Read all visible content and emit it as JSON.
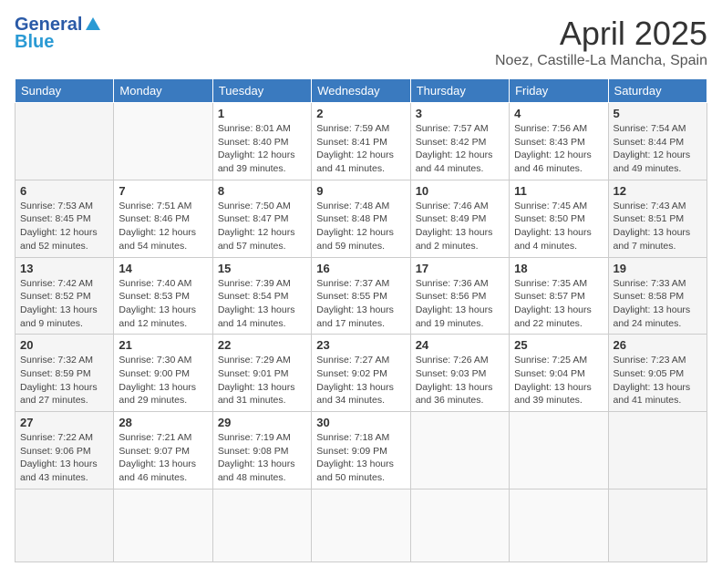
{
  "header": {
    "logo_general": "General",
    "logo_blue": "Blue",
    "title": "April 2025",
    "subtitle": "Noez, Castille-La Mancha, Spain"
  },
  "weekdays": [
    "Sunday",
    "Monday",
    "Tuesday",
    "Wednesday",
    "Thursday",
    "Friday",
    "Saturday"
  ],
  "days": [
    {
      "num": "",
      "sunrise": "",
      "sunset": "",
      "daylight": "",
      "empty": true
    },
    {
      "num": "",
      "sunrise": "",
      "sunset": "",
      "daylight": "",
      "empty": true
    },
    {
      "num": "1",
      "sunrise": "Sunrise: 8:01 AM",
      "sunset": "Sunset: 8:40 PM",
      "daylight": "Daylight: 12 hours and 39 minutes."
    },
    {
      "num": "2",
      "sunrise": "Sunrise: 7:59 AM",
      "sunset": "Sunset: 8:41 PM",
      "daylight": "Daylight: 12 hours and 41 minutes."
    },
    {
      "num": "3",
      "sunrise": "Sunrise: 7:57 AM",
      "sunset": "Sunset: 8:42 PM",
      "daylight": "Daylight: 12 hours and 44 minutes."
    },
    {
      "num": "4",
      "sunrise": "Sunrise: 7:56 AM",
      "sunset": "Sunset: 8:43 PM",
      "daylight": "Daylight: 12 hours and 46 minutes."
    },
    {
      "num": "5",
      "sunrise": "Sunrise: 7:54 AM",
      "sunset": "Sunset: 8:44 PM",
      "daylight": "Daylight: 12 hours and 49 minutes."
    },
    {
      "num": "6",
      "sunrise": "Sunrise: 7:53 AM",
      "sunset": "Sunset: 8:45 PM",
      "daylight": "Daylight: 12 hours and 52 minutes."
    },
    {
      "num": "7",
      "sunrise": "Sunrise: 7:51 AM",
      "sunset": "Sunset: 8:46 PM",
      "daylight": "Daylight: 12 hours and 54 minutes."
    },
    {
      "num": "8",
      "sunrise": "Sunrise: 7:50 AM",
      "sunset": "Sunset: 8:47 PM",
      "daylight": "Daylight: 12 hours and 57 minutes."
    },
    {
      "num": "9",
      "sunrise": "Sunrise: 7:48 AM",
      "sunset": "Sunset: 8:48 PM",
      "daylight": "Daylight: 12 hours and 59 minutes."
    },
    {
      "num": "10",
      "sunrise": "Sunrise: 7:46 AM",
      "sunset": "Sunset: 8:49 PM",
      "daylight": "Daylight: 13 hours and 2 minutes."
    },
    {
      "num": "11",
      "sunrise": "Sunrise: 7:45 AM",
      "sunset": "Sunset: 8:50 PM",
      "daylight": "Daylight: 13 hours and 4 minutes."
    },
    {
      "num": "12",
      "sunrise": "Sunrise: 7:43 AM",
      "sunset": "Sunset: 8:51 PM",
      "daylight": "Daylight: 13 hours and 7 minutes."
    },
    {
      "num": "13",
      "sunrise": "Sunrise: 7:42 AM",
      "sunset": "Sunset: 8:52 PM",
      "daylight": "Daylight: 13 hours and 9 minutes."
    },
    {
      "num": "14",
      "sunrise": "Sunrise: 7:40 AM",
      "sunset": "Sunset: 8:53 PM",
      "daylight": "Daylight: 13 hours and 12 minutes."
    },
    {
      "num": "15",
      "sunrise": "Sunrise: 7:39 AM",
      "sunset": "Sunset: 8:54 PM",
      "daylight": "Daylight: 13 hours and 14 minutes."
    },
    {
      "num": "16",
      "sunrise": "Sunrise: 7:37 AM",
      "sunset": "Sunset: 8:55 PM",
      "daylight": "Daylight: 13 hours and 17 minutes."
    },
    {
      "num": "17",
      "sunrise": "Sunrise: 7:36 AM",
      "sunset": "Sunset: 8:56 PM",
      "daylight": "Daylight: 13 hours and 19 minutes."
    },
    {
      "num": "18",
      "sunrise": "Sunrise: 7:35 AM",
      "sunset": "Sunset: 8:57 PM",
      "daylight": "Daylight: 13 hours and 22 minutes."
    },
    {
      "num": "19",
      "sunrise": "Sunrise: 7:33 AM",
      "sunset": "Sunset: 8:58 PM",
      "daylight": "Daylight: 13 hours and 24 minutes."
    },
    {
      "num": "20",
      "sunrise": "Sunrise: 7:32 AM",
      "sunset": "Sunset: 8:59 PM",
      "daylight": "Daylight: 13 hours and 27 minutes."
    },
    {
      "num": "21",
      "sunrise": "Sunrise: 7:30 AM",
      "sunset": "Sunset: 9:00 PM",
      "daylight": "Daylight: 13 hours and 29 minutes."
    },
    {
      "num": "22",
      "sunrise": "Sunrise: 7:29 AM",
      "sunset": "Sunset: 9:01 PM",
      "daylight": "Daylight: 13 hours and 31 minutes."
    },
    {
      "num": "23",
      "sunrise": "Sunrise: 7:27 AM",
      "sunset": "Sunset: 9:02 PM",
      "daylight": "Daylight: 13 hours and 34 minutes."
    },
    {
      "num": "24",
      "sunrise": "Sunrise: 7:26 AM",
      "sunset": "Sunset: 9:03 PM",
      "daylight": "Daylight: 13 hours and 36 minutes."
    },
    {
      "num": "25",
      "sunrise": "Sunrise: 7:25 AM",
      "sunset": "Sunset: 9:04 PM",
      "daylight": "Daylight: 13 hours and 39 minutes."
    },
    {
      "num": "26",
      "sunrise": "Sunrise: 7:23 AM",
      "sunset": "Sunset: 9:05 PM",
      "daylight": "Daylight: 13 hours and 41 minutes."
    },
    {
      "num": "27",
      "sunrise": "Sunrise: 7:22 AM",
      "sunset": "Sunset: 9:06 PM",
      "daylight": "Daylight: 13 hours and 43 minutes."
    },
    {
      "num": "28",
      "sunrise": "Sunrise: 7:21 AM",
      "sunset": "Sunset: 9:07 PM",
      "daylight": "Daylight: 13 hours and 46 minutes."
    },
    {
      "num": "29",
      "sunrise": "Sunrise: 7:19 AM",
      "sunset": "Sunset: 9:08 PM",
      "daylight": "Daylight: 13 hours and 48 minutes."
    },
    {
      "num": "30",
      "sunrise": "Sunrise: 7:18 AM",
      "sunset": "Sunset: 9:09 PM",
      "daylight": "Daylight: 13 hours and 50 minutes."
    },
    {
      "num": "",
      "sunrise": "",
      "sunset": "",
      "daylight": "",
      "empty": true
    },
    {
      "num": "",
      "sunrise": "",
      "sunset": "",
      "daylight": "",
      "empty": true
    },
    {
      "num": "",
      "sunrise": "",
      "sunset": "",
      "daylight": "",
      "empty": true
    }
  ]
}
